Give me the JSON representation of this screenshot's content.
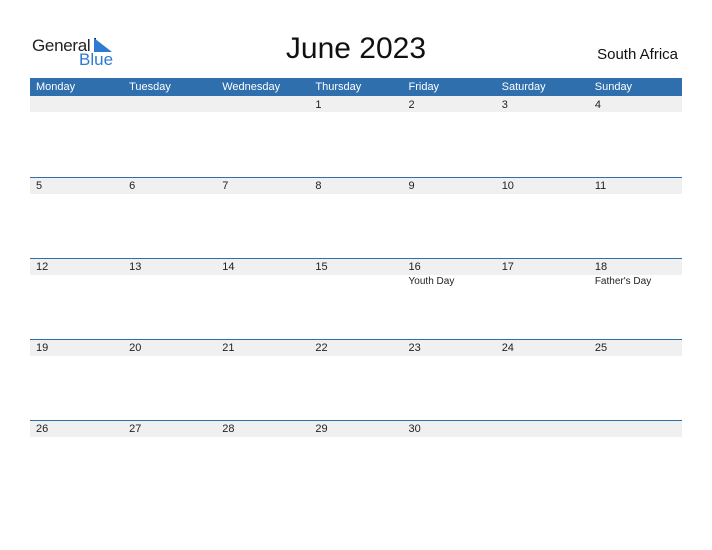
{
  "logo": {
    "general": "General",
    "blue": "Blue",
    "accent": "#2e7bd0"
  },
  "title": "June 2023",
  "country": "South Africa",
  "header_color": "#2f6fad",
  "days": [
    "Monday",
    "Tuesday",
    "Wednesday",
    "Thursday",
    "Friday",
    "Saturday",
    "Sunday"
  ],
  "weeks": [
    [
      {
        "d": ""
      },
      {
        "d": ""
      },
      {
        "d": ""
      },
      {
        "d": "1"
      },
      {
        "d": "2"
      },
      {
        "d": "3"
      },
      {
        "d": "4"
      }
    ],
    [
      {
        "d": "5"
      },
      {
        "d": "6"
      },
      {
        "d": "7"
      },
      {
        "d": "8"
      },
      {
        "d": "9"
      },
      {
        "d": "10"
      },
      {
        "d": "11"
      }
    ],
    [
      {
        "d": "12"
      },
      {
        "d": "13"
      },
      {
        "d": "14"
      },
      {
        "d": "15"
      },
      {
        "d": "16",
        "e": "Youth Day"
      },
      {
        "d": "17"
      },
      {
        "d": "18",
        "e": "Father's Day"
      }
    ],
    [
      {
        "d": "19"
      },
      {
        "d": "20"
      },
      {
        "d": "21"
      },
      {
        "d": "22"
      },
      {
        "d": "23"
      },
      {
        "d": "24"
      },
      {
        "d": "25"
      }
    ],
    [
      {
        "d": "26"
      },
      {
        "d": "27"
      },
      {
        "d": "28"
      },
      {
        "d": "29"
      },
      {
        "d": "30"
      },
      {
        "d": ""
      },
      {
        "d": ""
      }
    ]
  ]
}
